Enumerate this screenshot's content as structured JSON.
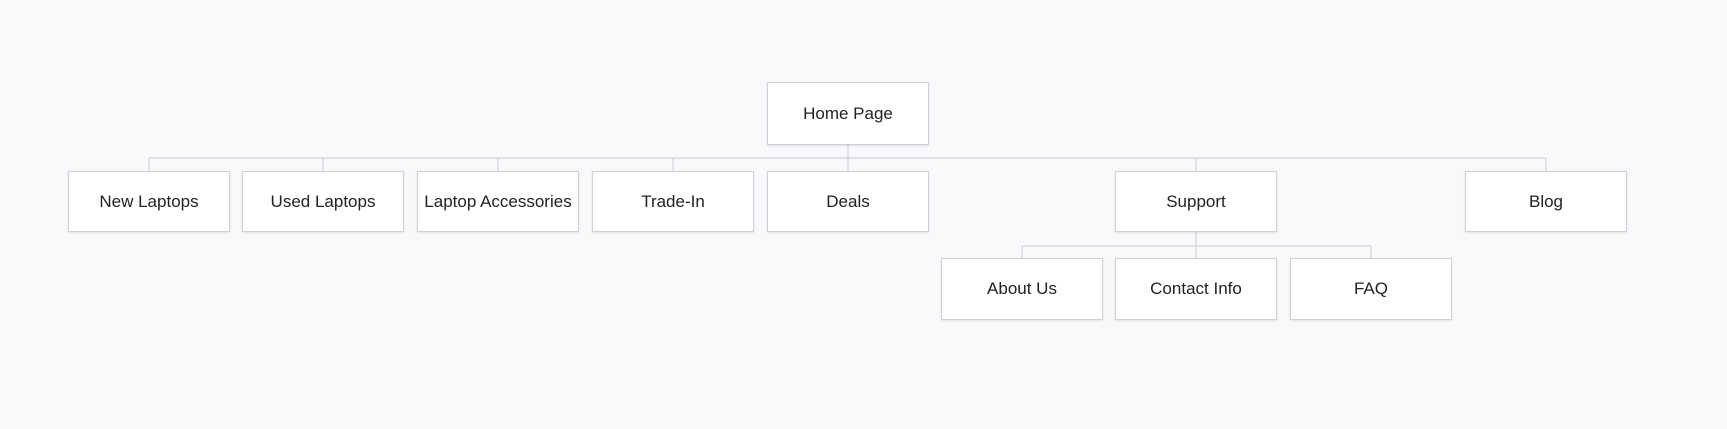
{
  "sitemap": {
    "root": {
      "id": "home",
      "label": "Home Page"
    },
    "sections": [
      {
        "id": "new-laptops",
        "label": "New Laptops"
      },
      {
        "id": "used-laptops",
        "label": "Used Laptops"
      },
      {
        "id": "laptop-accessories",
        "label": "Laptop Accessories"
      },
      {
        "id": "trade-in",
        "label": "Trade-In"
      },
      {
        "id": "deals",
        "label": "Deals"
      },
      {
        "id": "support",
        "label": "Support",
        "children": [
          {
            "id": "about-us",
            "label": "About Us"
          },
          {
            "id": "contact-info",
            "label": "Contact Info"
          },
          {
            "id": "faq",
            "label": "FAQ"
          }
        ]
      },
      {
        "id": "blog",
        "label": "Blog"
      }
    ]
  }
}
